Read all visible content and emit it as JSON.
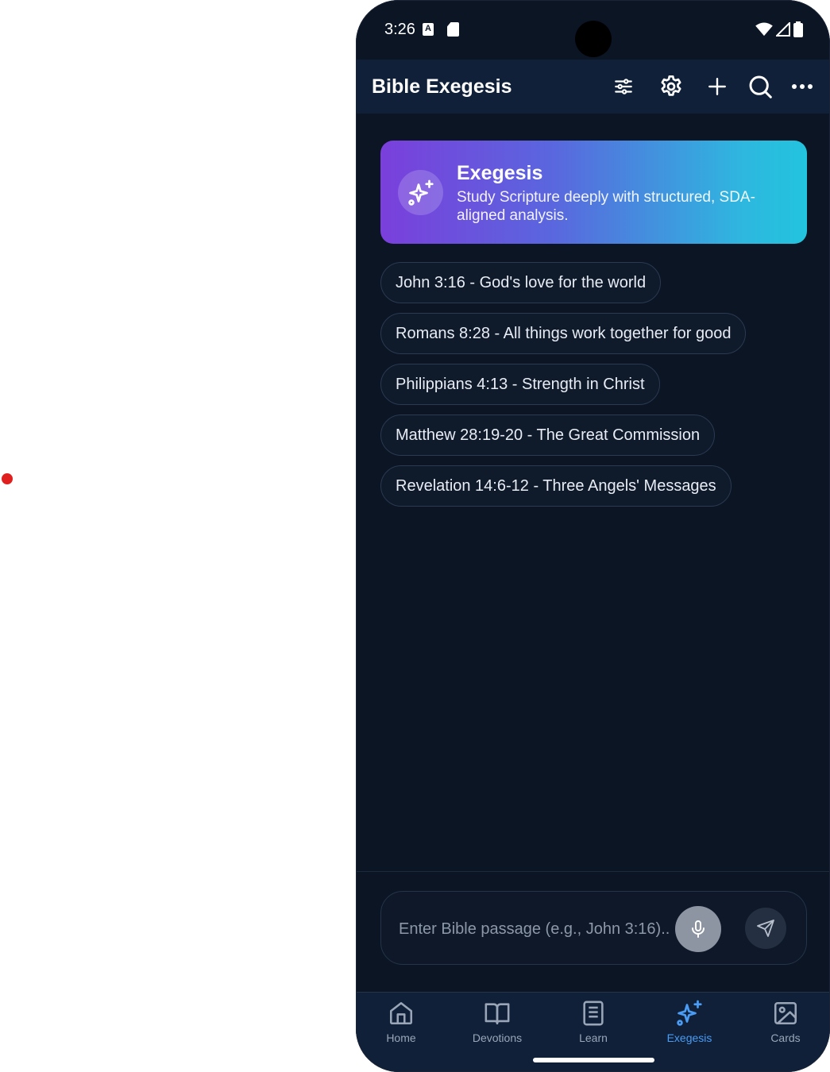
{
  "status_bar": {
    "time": "3:26"
  },
  "app_bar": {
    "title": "Bible Exegesis",
    "actions": [
      "sliders-icon",
      "gear-icon",
      "plus-icon",
      "search-icon",
      "more-icon"
    ]
  },
  "hero": {
    "title": "Exegesis",
    "description": "Study Scripture deeply with structured, SDA-aligned analysis.",
    "icon": "sparkles-icon"
  },
  "suggestions": [
    "John 3:16 - God's love for the world",
    "Romans 8:28 - All things work together for good",
    "Philippians 4:13 - Strength in Christ",
    "Matthew 28:19-20 - The Great Commission",
    "Revelation 14:6-12 - Three Angels' Messages"
  ],
  "input": {
    "placeholder": "Enter Bible passage (e.g., John 3:16)..",
    "value": ""
  },
  "bottom_nav": {
    "items": [
      {
        "label": "Home",
        "icon": "home-icon"
      },
      {
        "label": "Devotions",
        "icon": "book-open-icon"
      },
      {
        "label": "Learn",
        "icon": "notebook-icon"
      },
      {
        "label": "Exegesis",
        "icon": "sparkles-icon",
        "active": true
      },
      {
        "label": "Cards",
        "icon": "image-icon"
      }
    ]
  },
  "colors": {
    "background": "#0b1524",
    "app_bar": "#0f2038",
    "accent": "#4a9cf5",
    "gradient_start": "#7a3fdc",
    "gradient_end": "#22c4de"
  }
}
